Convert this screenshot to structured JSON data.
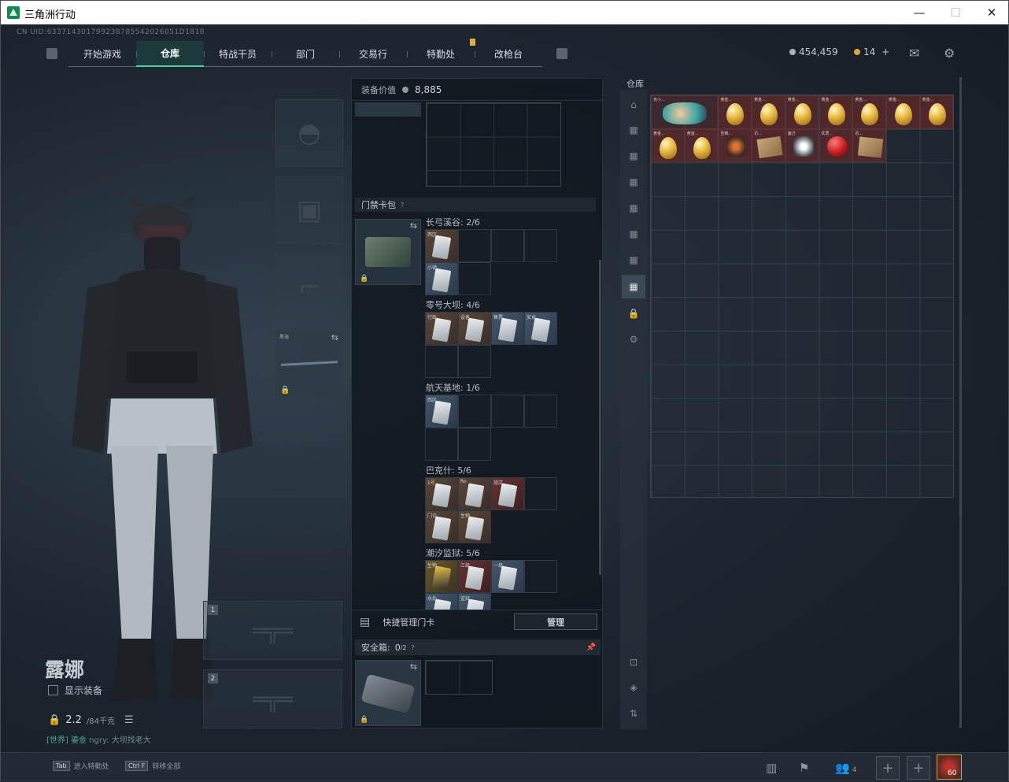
{
  "window": {
    "title": "三角洲行动"
  },
  "uid": "CN UID:633714301799238785542026051D1818",
  "nav": {
    "tabs": [
      "开始游戏",
      "仓库",
      "特战干员",
      "部门",
      "交易行",
      "特勤处",
      "改枪台"
    ],
    "active": "仓库"
  },
  "currency": {
    "silver": "454,459",
    "gold": "14",
    "plus": "+"
  },
  "equipment": {
    "weapon_slot_1": "1",
    "weapon_slot_2": "2",
    "melee_label": "黑海"
  },
  "character": {
    "name": "露娜",
    "show_equipment": "显示装备",
    "weight": "2.2",
    "weight_max": "/84千克",
    "chat_channel": "[世界]",
    "chat_user": "鎏金",
    "chat_text": "ngry: 大坝找老大"
  },
  "loadout": {
    "value_label": "装备价值",
    "value": "8,885"
  },
  "keycard": {
    "section_title": "门禁卡包",
    "help": "?",
    "maps": [
      {
        "name": "长弓溪谷: 2/6"
      },
      {
        "name": "零号大坝: 4/6"
      },
      {
        "name": "航天基地: 1/6"
      },
      {
        "name": "巴克什: 5/6"
      },
      {
        "name": "潮汐监狱: 5/6"
      }
    ],
    "quick_manage": "快捷管理门卡",
    "manage_btn": "管理"
  },
  "safe_box": {
    "title": "安全箱:",
    "count": "0",
    "capacity": "/2",
    "help": "?"
  },
  "stash": {
    "title": "仓库",
    "items": [
      {
        "label": "克小..."
      },
      {
        "label": "黄金..."
      },
      {
        "label": "黄金..."
      },
      {
        "label": "黄金..."
      },
      {
        "label": "黄金..."
      },
      {
        "label": "黄金..."
      },
      {
        "label": "黄金..."
      },
      {
        "label": "黄金..."
      },
      {
        "label": "黄金..."
      },
      {
        "label": "黄金..."
      },
      {
        "label": "至精..."
      },
      {
        "label": "讯..."
      },
      {
        "label": "魔方"
      },
      {
        "label": "优质..."
      },
      {
        "label": "讯..."
      }
    ]
  },
  "bottom": {
    "hint1_key": "Tab",
    "hint1": "进入特勤处",
    "hint2_key": "Ctrl F",
    "hint2": "转移全部",
    "friends": "4",
    "level": "60"
  },
  "colors": {
    "accent": "#4fd1a5",
    "gold": "#e8b023"
  }
}
